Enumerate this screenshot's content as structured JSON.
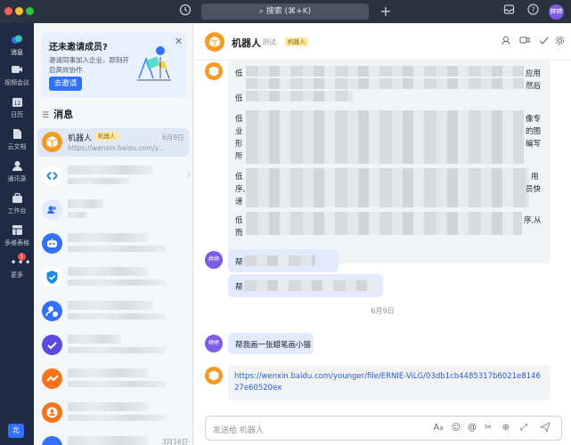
{
  "topbar": {
    "search_label": "搜索 (⌘+K)",
    "avatar_text": "婷婷"
  },
  "leftnav": {
    "items": [
      {
        "label": "消息",
        "icon": "message-icon"
      },
      {
        "label": "视频会议",
        "icon": "video-icon"
      },
      {
        "label": "日历",
        "icon": "calendar-icon"
      },
      {
        "label": "云文档",
        "icon": "doc-icon"
      },
      {
        "label": "通讯录",
        "icon": "contacts-icon"
      },
      {
        "label": "工作台",
        "icon": "workbench-icon"
      },
      {
        "label": "多维表格",
        "icon": "table-icon"
      },
      {
        "label": "更多",
        "icon": "more-icon"
      }
    ],
    "more_badge": "1",
    "bottom_a": "北",
    "bottom_b": "1"
  },
  "invite": {
    "title": "还未邀请成员?",
    "desc": "邀请同事加入企业，即刻开启高效协作",
    "button": "去邀请"
  },
  "list": {
    "header": "消息",
    "first": {
      "name": "机器人",
      "tag": "机器人",
      "date": "6月9日",
      "preview": "https://wenxin.baidu.com/y..."
    },
    "last_date": "3月16日"
  },
  "chat": {
    "title": "机器人",
    "subtitle": "测试",
    "tag": "机器人",
    "msg1": {
      "line1_start": "低",
      "line1_end": "应用",
      "line2_end": "然后",
      "line3_start": "低",
      "p2_l1": "低",
      "p2_l1_end": "像专",
      "p2_l2": "业",
      "p2_l2_end": "的图",
      "p2_l3": "形",
      "p2_l3_end": "编写",
      "p2_l4": "所",
      "p3_l1": "低",
      "p3_l1_end": "用",
      "p3_l2": "序,",
      "p3_l2_end": "员快",
      "p3_l3": "速",
      "p4_l1": "低",
      "p4_l1_end": "序,从",
      "p4_l2": "而"
    },
    "user_avatar": "婷婷",
    "msg2_a": "帮",
    "msg2_b": "帮",
    "date_sep": "6月9日",
    "msg3": "帮我画一张蜡笔画小猫",
    "msg4_link": "https://wenxin.baidu.com/younger/file/ERNIE-ViLG/03db1cb4485317b6021e814627e60520ex"
  },
  "input": {
    "placeholder": "发送给 机器人"
  },
  "colors": {
    "brand": "#3370ff",
    "nav_bg": "#1f2a44",
    "bot_orange": "#f59a23",
    "user_purple": "#7b5ce6"
  }
}
